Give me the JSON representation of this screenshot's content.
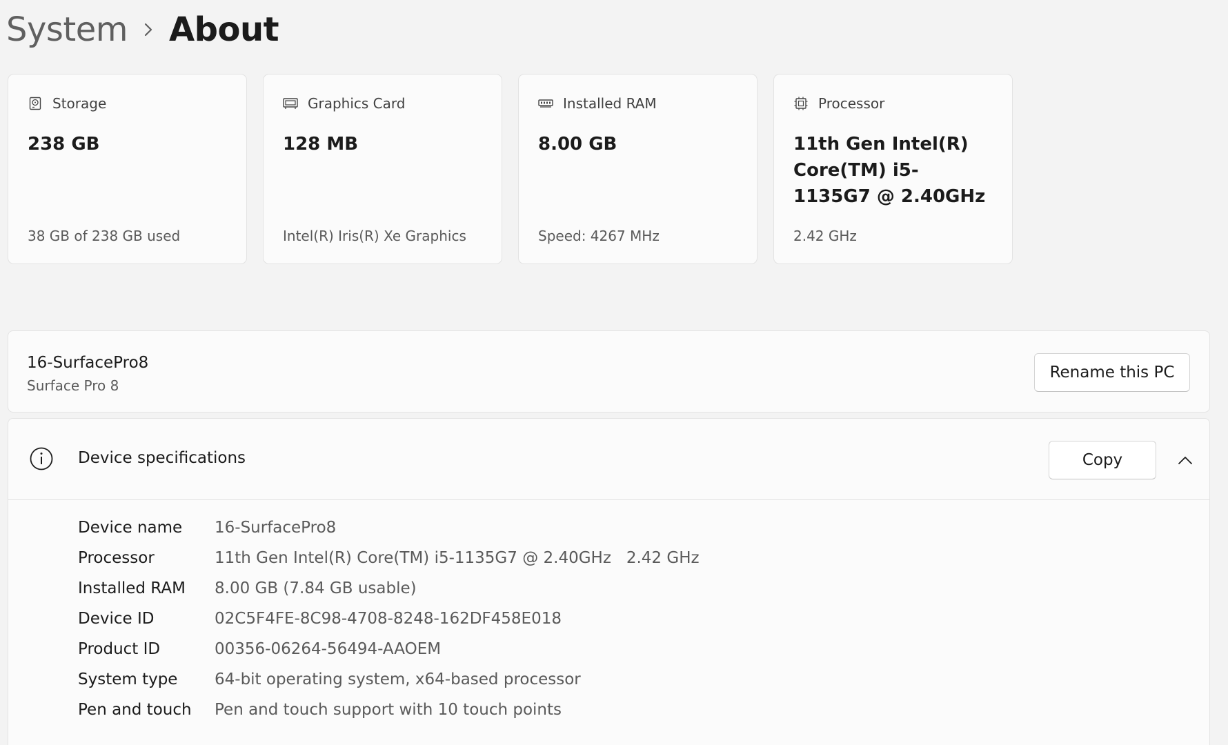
{
  "breadcrumb": {
    "parent": "System",
    "current": "About"
  },
  "cards": [
    {
      "icon": "storage-icon",
      "title": "Storage",
      "value": "238 GB",
      "sub": "38 GB of 238 GB used"
    },
    {
      "icon": "graphics-card-icon",
      "title": "Graphics Card",
      "value": "128 MB",
      "sub": "Intel(R) Iris(R) Xe Graphics"
    },
    {
      "icon": "ram-icon",
      "title": "Installed RAM",
      "value": "8.00 GB",
      "sub": "Speed: 4267 MHz"
    },
    {
      "icon": "processor-icon",
      "title": "Processor",
      "value": "11th Gen Intel(R) Core(TM) i5-1135G7 @ 2.40GHz",
      "sub": "2.42 GHz"
    }
  ],
  "pc": {
    "name": "16-SurfacePro8",
    "model": "Surface Pro 8",
    "rename_label": "Rename this PC"
  },
  "specs": {
    "icon": "info-icon",
    "title": "Device specifications",
    "copy_label": "Copy",
    "collapse_icon": "chevron-up-icon",
    "rows": [
      {
        "label": "Device name",
        "value": "16-SurfacePro8"
      },
      {
        "label": "Processor",
        "value": "11th Gen Intel(R) Core(TM) i5-1135G7 @ 2.40GHz   2.42 GHz"
      },
      {
        "label": "Installed RAM",
        "value": "8.00 GB (7.84 GB usable)"
      },
      {
        "label": "Device ID",
        "value": "02C5F4FE-8C98-4708-8248-162DF458E018"
      },
      {
        "label": "Product ID",
        "value": "00356-06264-56494-AAOEM"
      },
      {
        "label": "System type",
        "value": "64-bit operating system, x64-based processor"
      },
      {
        "label": "Pen and touch",
        "value": "Pen and touch support with 10 touch points"
      }
    ]
  },
  "colors": {
    "background": "#f3f3f3",
    "card": "#fbfbfb",
    "border": "#e3e3e3",
    "text_primary": "#1b1b1b",
    "text_secondary": "#5a5a5a"
  }
}
